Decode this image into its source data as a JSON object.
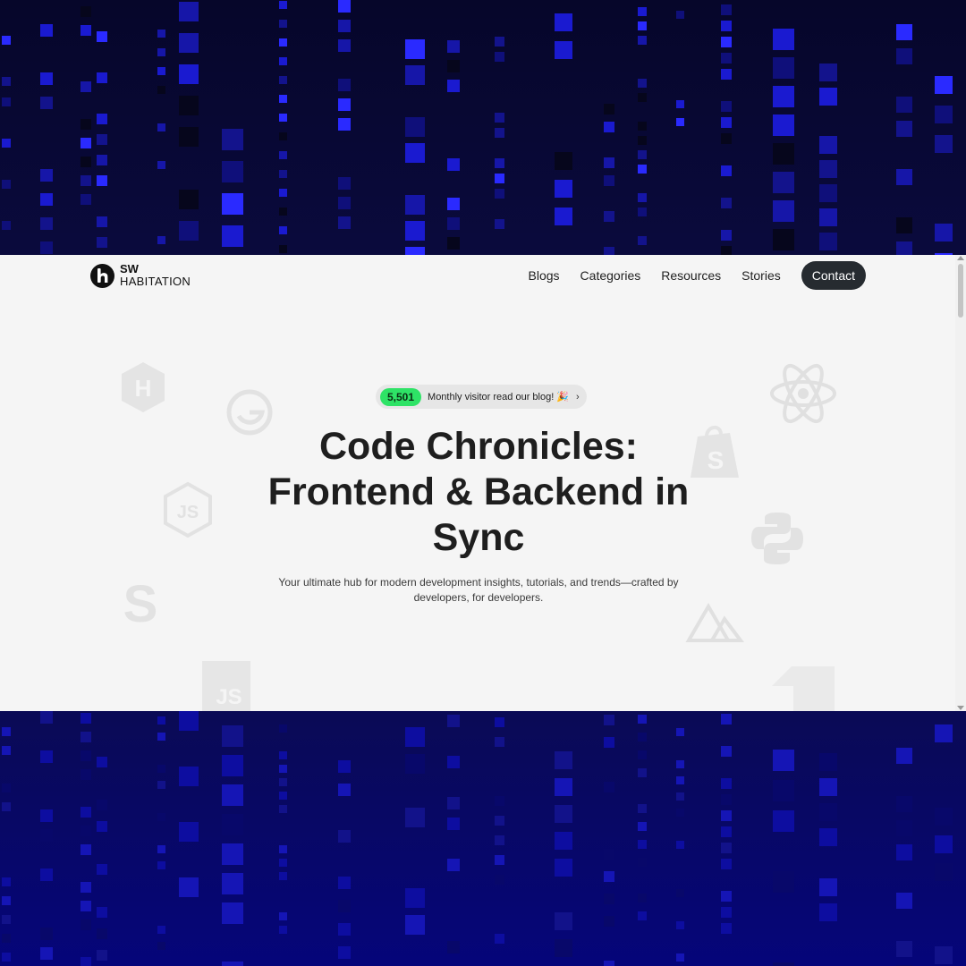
{
  "brand": {
    "line1": "SW",
    "line2": "HABITATION",
    "mark_letter": "h"
  },
  "nav": {
    "items": [
      {
        "label": "Blogs"
      },
      {
        "label": "Categories"
      },
      {
        "label": "Resources"
      },
      {
        "label": "Stories"
      }
    ],
    "contact_label": "Contact"
  },
  "hero": {
    "badge": {
      "count": "5,501",
      "text": "Monthly visitor read our blog!",
      "emoji": "🎉",
      "chevron": "›"
    },
    "title": "Code Chronicles: Frontend & Backend in Sync",
    "subtitle": "Your ultimate hub for modern development insights, tutorials, and trends—crafted by developers, for developers."
  },
  "tech_logos": [
    {
      "icon": "hugo-icon",
      "glyph": "H"
    },
    {
      "icon": "gatsby-icon",
      "glyph": "G"
    },
    {
      "icon": "nodejs-icon",
      "glyph": "JS"
    },
    {
      "icon": "sass-icon",
      "glyph": "S"
    },
    {
      "icon": "javascript-icon",
      "glyph": "JS"
    },
    {
      "icon": "react-icon",
      "glyph": ""
    },
    {
      "icon": "shopify-icon",
      "glyph": "S"
    },
    {
      "icon": "python-icon",
      "glyph": ""
    },
    {
      "icon": "nuxt-icon",
      "glyph": ""
    },
    {
      "icon": "block-icon",
      "glyph": ""
    }
  ],
  "colors": {
    "page_bg": "#f5f5f5",
    "contact_bg": "#262b30",
    "badge_count_bg": "#2ee366",
    "matrix_top": "#06062a",
    "matrix_bottom": "#05057a",
    "matrix_cell": "#1a1ad0"
  }
}
